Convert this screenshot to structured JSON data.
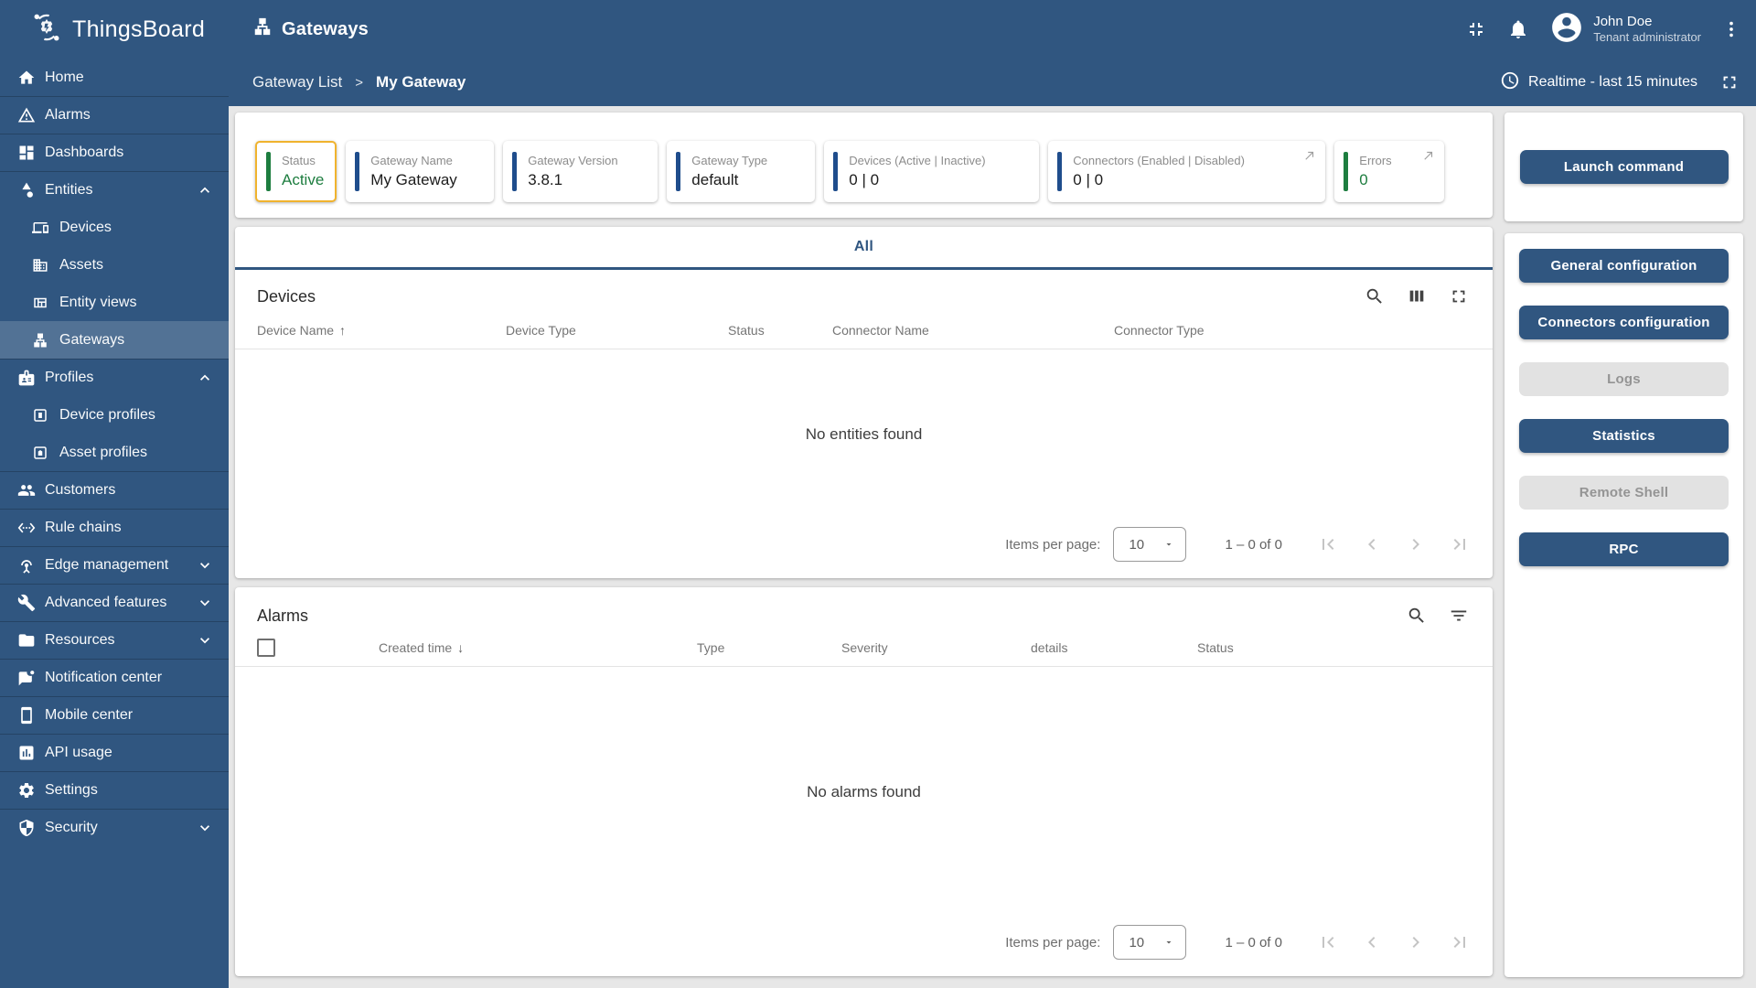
{
  "app": {
    "name": "ThingsBoard"
  },
  "header": {
    "title": "Gateways",
    "user": {
      "name": "John Doe",
      "role": "Tenant administrator"
    }
  },
  "breadcrumb": {
    "parent": "Gateway List",
    "sep": ">",
    "current": "My Gateway"
  },
  "timewindow": {
    "label": "Realtime - last 15 minutes"
  },
  "sidebar": {
    "items": [
      {
        "label": "Home",
        "level": "top"
      },
      {
        "label": "Alarms",
        "level": "top"
      },
      {
        "label": "Dashboards",
        "level": "top"
      },
      {
        "label": "Entities",
        "level": "top",
        "expanded": true
      },
      {
        "label": "Devices",
        "level": "sub"
      },
      {
        "label": "Assets",
        "level": "sub"
      },
      {
        "label": "Entity views",
        "level": "sub"
      },
      {
        "label": "Gateways",
        "level": "sub",
        "selected": true
      },
      {
        "label": "Profiles",
        "level": "top",
        "expanded": true
      },
      {
        "label": "Device profiles",
        "level": "sub"
      },
      {
        "label": "Asset profiles",
        "level": "sub"
      },
      {
        "label": "Customers",
        "level": "top"
      },
      {
        "label": "Rule chains",
        "level": "top"
      },
      {
        "label": "Edge management",
        "level": "top",
        "expanded": false
      },
      {
        "label": "Advanced features",
        "level": "top",
        "expanded": false
      },
      {
        "label": "Resources",
        "level": "top",
        "expanded": false
      },
      {
        "label": "Notification center",
        "level": "top"
      },
      {
        "label": "Mobile center",
        "level": "top"
      },
      {
        "label": "API usage",
        "level": "top"
      },
      {
        "label": "Settings",
        "level": "top"
      },
      {
        "label": "Security",
        "level": "top",
        "expanded": false
      }
    ]
  },
  "status_cards": [
    {
      "label": "Status",
      "value": "Active",
      "accent": "green",
      "highlighted": true
    },
    {
      "label": "Gateway Name",
      "value": "My Gateway",
      "accent": "blue"
    },
    {
      "label": "Gateway Version",
      "value": "3.8.1",
      "accent": "blue"
    },
    {
      "label": "Gateway Type",
      "value": "default",
      "accent": "blue"
    },
    {
      "label": "Devices (Active | Inactive)",
      "value": "0 | 0",
      "accent": "blue"
    },
    {
      "label": "Connectors (Enabled | Disabled)",
      "value": "0 | 0",
      "accent": "blue",
      "external_link": true
    },
    {
      "label": "Errors",
      "value": "0",
      "accent": "green",
      "external_link": true
    }
  ],
  "tabbar": {
    "active": "All"
  },
  "devices": {
    "title": "Devices",
    "columns": [
      "Device Name",
      "Device Type",
      "Status",
      "Connector Name",
      "Connector Type"
    ],
    "sort": {
      "column": "Device Name",
      "direction": "asc"
    },
    "empty": "No entities found",
    "pager": {
      "items_label": "Items per page:",
      "size": "10",
      "range": "1 – 0 of 0"
    }
  },
  "alarms": {
    "title": "Alarms",
    "columns": [
      "Created time",
      "Type",
      "Severity",
      "details",
      "Status"
    ],
    "sort": {
      "column": "Created time",
      "direction": "desc"
    },
    "empty": "No alarms found",
    "pager": {
      "items_label": "Items per page:",
      "size": "10",
      "range": "1 – 0 of 0"
    }
  },
  "actions": {
    "launch_label": "Launch command",
    "items": [
      {
        "label": "General configuration",
        "enabled": true
      },
      {
        "label": "Connectors configuration",
        "enabled": true
      },
      {
        "label": "Logs",
        "enabled": false
      },
      {
        "label": "Statistics",
        "enabled": true
      },
      {
        "label": "Remote Shell",
        "enabled": false
      },
      {
        "label": "RPC",
        "enabled": true
      }
    ]
  },
  "colors": {
    "primary": "#305680",
    "accent_blue": "#1f4d8c",
    "green": "#1d7d3f",
    "highlight_border": "#f0b32e"
  }
}
